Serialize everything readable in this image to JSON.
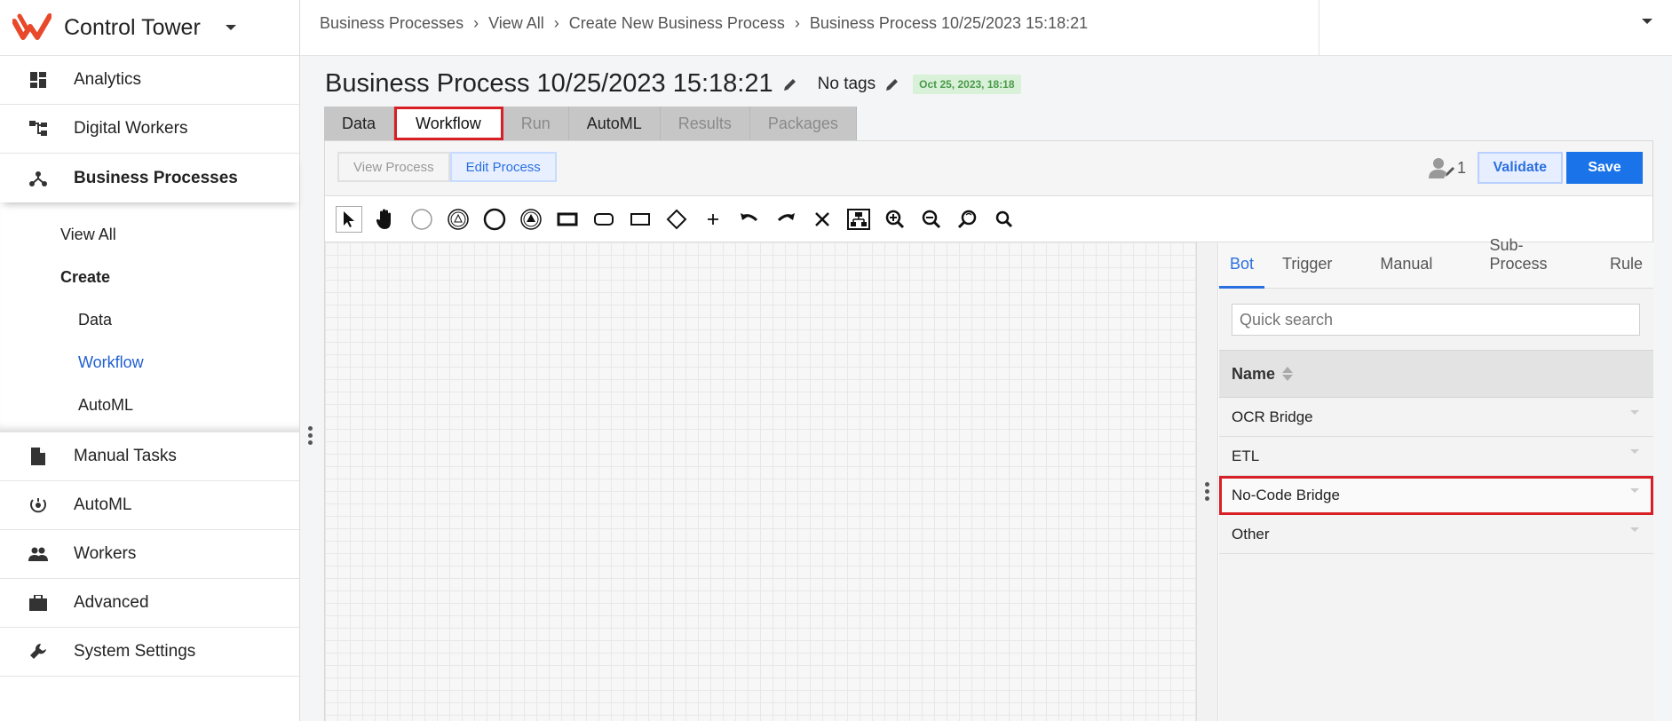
{
  "app": {
    "title": "Control Tower"
  },
  "sidebar": {
    "items": [
      {
        "label": "Analytics",
        "icon": "dashboard-icon"
      },
      {
        "label": "Digital Workers",
        "icon": "hierarchy-icon"
      },
      {
        "label": "Business Processes",
        "icon": "process-icon"
      },
      {
        "label": "Manual Tasks",
        "icon": "document-icon"
      },
      {
        "label": "AutoML",
        "icon": "automl-icon"
      },
      {
        "label": "Workers",
        "icon": "people-icon"
      },
      {
        "label": "Advanced",
        "icon": "briefcase-icon"
      },
      {
        "label": "System Settings",
        "icon": "wrench-icon"
      }
    ],
    "subnav": {
      "view_all": "View All",
      "create": "Create",
      "data": "Data",
      "workflow": "Workflow",
      "automl": "AutoML"
    }
  },
  "breadcrumb": [
    "Business Processes",
    "View All",
    "Create New Business Process",
    "Business Process 10/25/2023 15:18:21"
  ],
  "page": {
    "title": "Business Process 10/25/2023 15:18:21",
    "tags": "No tags",
    "date_badge": "Oct 25, 2023, 18:18"
  },
  "main_tabs": [
    "Data",
    "Workflow",
    "Run",
    "AutoML",
    "Results",
    "Packages"
  ],
  "toolbar": {
    "view_process": "View Process",
    "edit_process": "Edit Process",
    "user_count": "1",
    "validate": "Validate",
    "save": "Save"
  },
  "palette": {
    "tabs": [
      "Bot",
      "Trigger",
      "Manual",
      "Sub-Process",
      "Rule"
    ],
    "search_placeholder": "Quick search",
    "column_header": "Name",
    "categories": [
      "OCR Bridge",
      "ETL",
      "No-Code Bridge",
      "Other"
    ]
  },
  "colors": {
    "accent": "#1a73e8",
    "highlight": "#d81f26",
    "logo": "#e8492b"
  }
}
